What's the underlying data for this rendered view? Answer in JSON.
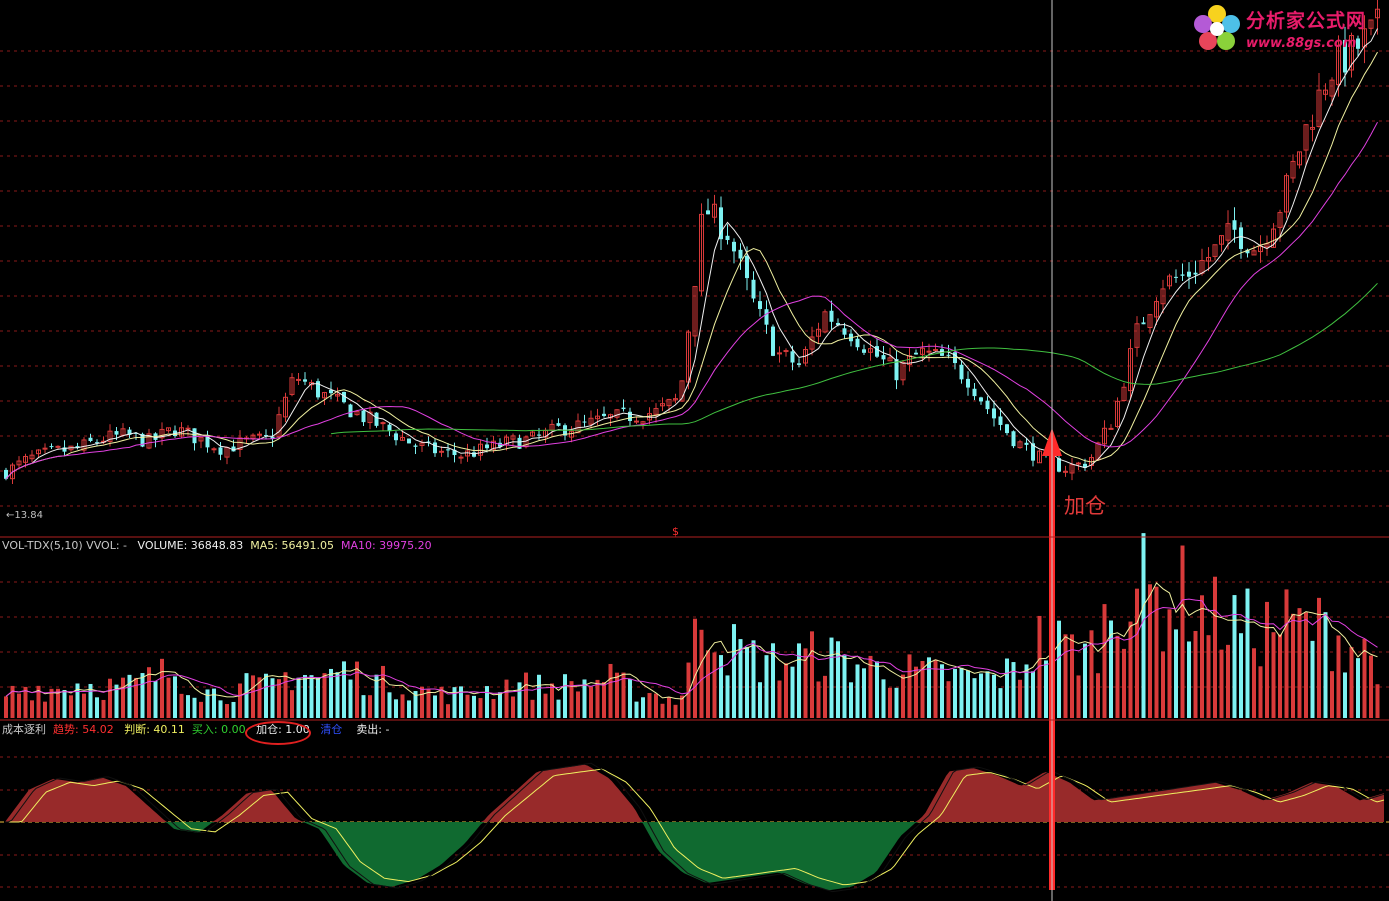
{
  "colors": {
    "up": "#d83a3a",
    "down": "#7ef2f2",
    "ma5": "#f0f0f0",
    "ma10": "#f0f0a0",
    "ma20": "#e040e0",
    "ma60": "#40c040",
    "grid": "#8a1a1a",
    "pos_fill": "#982a2a",
    "neg_fill": "#106a30",
    "arrow": "#ff2a2a"
  },
  "logo": {
    "title": "分析家公式网",
    "url": "www.88gs.com",
    "icon": "flower-icon"
  },
  "price_panel": {
    "low_marker": "13.84",
    "separator_mark": "$"
  },
  "annotation": {
    "text": "加仓"
  },
  "vol_legend": [
    {
      "text": "VOL-TDX(5,10) VVOL: -",
      "color": "#c8c8c8"
    },
    {
      "text": "VOLUME: 36848.83",
      "color": "#f0f0f0"
    },
    {
      "text": "MA5: 56491.05",
      "color": "#f0f0a0"
    },
    {
      "text": "MA10: 39975.20",
      "color": "#e040e0"
    }
  ],
  "ind_legend": [
    {
      "text": "成本逐利",
      "color": "#c8c8c8"
    },
    {
      "text": "趋势: 54.02",
      "color": "#ff3030"
    },
    {
      "text": "判断: 40.11",
      "color": "#f0f060"
    },
    {
      "text": "买入: 0.00",
      "color": "#30d030"
    },
    {
      "text": "加仓: 1.00",
      "color": "#f0f0f0"
    },
    {
      "text": "清仓",
      "color": "#3050ff"
    },
    {
      "text": "卖出: -",
      "color": "#f0f0f0"
    }
  ],
  "chart_data": {
    "type": "candlestick",
    "price_path": [
      14.0,
      14.8,
      15.2,
      15.4,
      16.0,
      16.2,
      15.8,
      16.6,
      16.0,
      15.4,
      15.8,
      16.0,
      19.8,
      18.8,
      18.0,
      17.2,
      16.4,
      15.6,
      15.2,
      15.0,
      15.4,
      15.8,
      16.0,
      16.6,
      16.8,
      17.2,
      17.4,
      17.6,
      18.4,
      30.0,
      28.4,
      24.4,
      21.2,
      20.4,
      23.6,
      22.6,
      21.2,
      20.0,
      21.2,
      20.8,
      19.6,
      17.4,
      15.8,
      14.8,
      14.2,
      14.6,
      17.2,
      22.4,
      25.4,
      25.8,
      27.0,
      28.6,
      27.4,
      30.2,
      34.6,
      38.2,
      39.4,
      40.8
    ],
    "volume_path": [
      0.15,
      0.2,
      0.18,
      0.22,
      0.2,
      0.2,
      0.25,
      0.3,
      0.18,
      0.15,
      0.2,
      0.2,
      0.3,
      0.25,
      0.3,
      0.25,
      0.22,
      0.18,
      0.15,
      0.15,
      0.18,
      0.22,
      0.2,
      0.2,
      0.22,
      0.25,
      0.18,
      0.15,
      0.1,
      0.7,
      0.45,
      0.38,
      0.35,
      0.38,
      0.4,
      0.35,
      0.32,
      0.3,
      0.28,
      0.28,
      0.25,
      0.25,
      0.3,
      0.5,
      0.45,
      0.4,
      0.7,
      0.85,
      0.72,
      0.78,
      0.65,
      0.6,
      0.55,
      0.6,
      0.58,
      0.55,
      0.45,
      0.38
    ],
    "indicator_path": [
      0,
      45,
      60,
      55,
      62,
      50,
      20,
      -10,
      -15,
      10,
      40,
      45,
      5,
      -10,
      -60,
      -85,
      -90,
      -80,
      -60,
      -30,
      10,
      40,
      70,
      75,
      80,
      60,
      20,
      -40,
      -70,
      -85,
      -80,
      -75,
      -70,
      -85,
      -95,
      -90,
      -70,
      -20,
      10,
      70,
      75,
      65,
      50,
      70,
      55,
      30,
      35,
      40,
      45,
      50,
      55,
      45,
      30,
      40,
      55,
      50,
      30,
      40
    ],
    "candles_count": 212,
    "ma_periods": [
      5,
      10,
      20,
      60
    ],
    "volume_ma_periods": [
      5,
      10
    ]
  }
}
